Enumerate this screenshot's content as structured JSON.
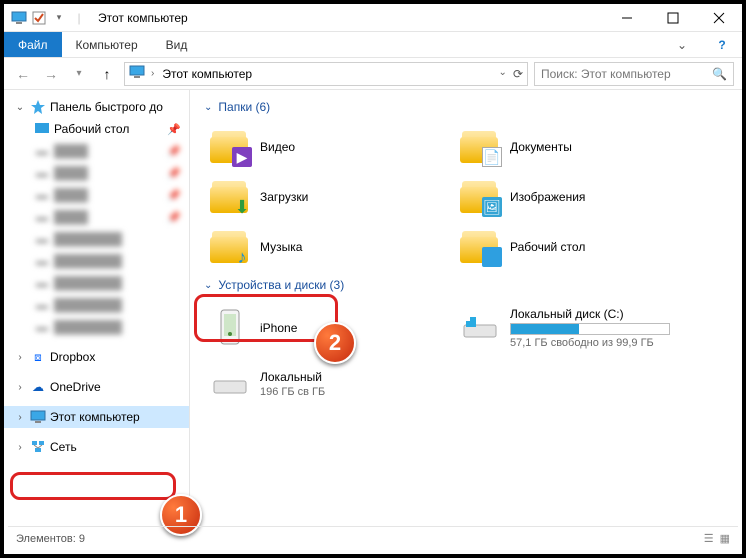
{
  "title": "Этот компьютер",
  "ribbon": {
    "file": "Файл",
    "computer": "Компьютер",
    "view": "Вид"
  },
  "address": {
    "root": "Этот компьютер"
  },
  "search": {
    "placeholder": "Поиск: Этот компьютер"
  },
  "nav": {
    "quick_access": "Панель быстрого до",
    "desktop": "Рабочий стол",
    "dropbox": "Dropbox",
    "onedrive": "OneDrive",
    "this_pc": "Этот компьютер",
    "network": "Сеть"
  },
  "groups": {
    "folders": {
      "title": "Папки",
      "count": 6
    },
    "devices": {
      "title": "Устройства и диски",
      "count": 3
    }
  },
  "folders": {
    "video": "Видео",
    "documents": "Документы",
    "downloads": "Загрузки",
    "pictures": "Изображения",
    "music": "Музыка",
    "desktop": "Рабочий стол"
  },
  "devices": {
    "iphone": {
      "name": "iPhone"
    },
    "disk_c": {
      "name": "Локальный диск (C:)",
      "sub": "57,1 ГБ свободно из 99,9 ГБ",
      "used_pct": 43
    },
    "disk_d": {
      "name": "Локальный",
      "sub": "196 ГБ св                       ГБ"
    }
  },
  "status": {
    "elements_label": "Элементов:",
    "elements_count": 9
  },
  "annotations": {
    "one": "1",
    "two": "2"
  }
}
